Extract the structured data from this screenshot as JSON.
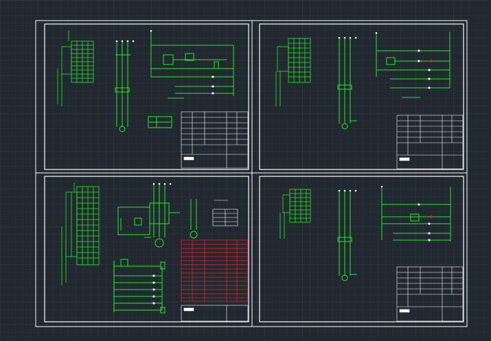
{
  "app": {
    "view": "model-space",
    "colors": {
      "background": "#212830",
      "grid_minor": "#2a323c",
      "grid_major": "#333c48",
      "frame": "#ffffff",
      "wire": "#22ee22",
      "table_highlight": "#ee2222",
      "label_text": "#ffffff"
    }
  },
  "drawing": {
    "layout": "2x2 sheet grid",
    "sheets": [
      {
        "id": "sheet-1",
        "position": "top-left"
      },
      {
        "id": "sheet-2",
        "position": "top-right"
      },
      {
        "id": "sheet-3",
        "position": "bottom-left"
      },
      {
        "id": "sheet-4",
        "position": "bottom-right"
      }
    ]
  }
}
